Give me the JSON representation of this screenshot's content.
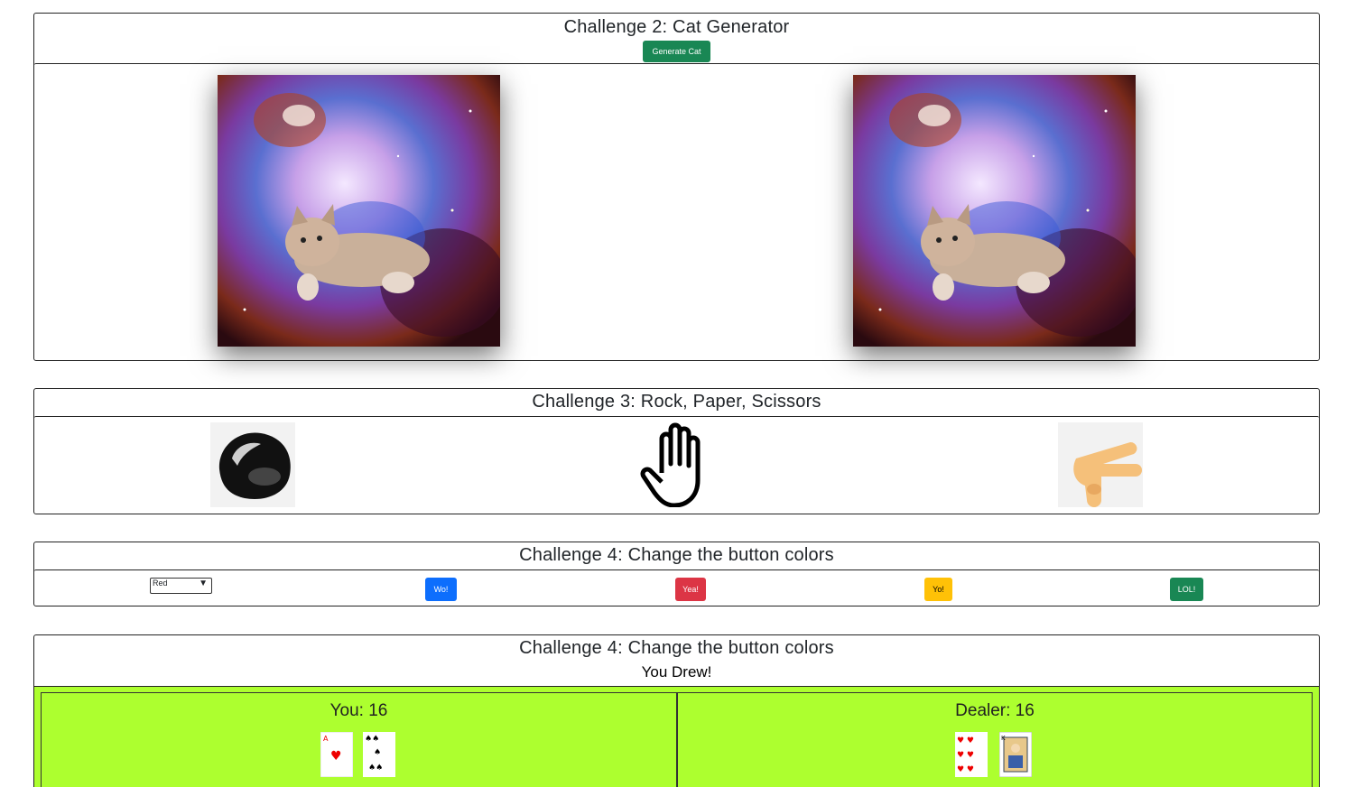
{
  "challenge2": {
    "title": "Challenge 2: Cat Generator",
    "button_label": "Generate Cat",
    "images": [
      "cat-in-space-image",
      "cat-in-space-image"
    ]
  },
  "challenge3": {
    "title": "Challenge 3: Rock, Paper, Scissors",
    "choices": [
      "rock-icon",
      "paper-hand-icon",
      "scissors-hand-icon"
    ]
  },
  "challenge4": {
    "title": "Challenge 4: Change the button colors",
    "select_value": "Red",
    "buttons": [
      {
        "label": "Wo!",
        "color": "#0d6efd"
      },
      {
        "label": "Yea!",
        "color": "#dc3545"
      },
      {
        "label": "Yo!",
        "color": "#ffc107"
      },
      {
        "label": "LOL!",
        "color": "#198754"
      }
    ]
  },
  "blackjack": {
    "title": "Challenge 4: Change the button colors",
    "result": "You Drew!",
    "you_label": "You: 16",
    "dealer_label": "Dealer: 16",
    "you_cards": [
      "ace-of-hearts-card",
      "five-of-spades-card"
    ],
    "dealer_cards": [
      "six-of-hearts-card",
      "king-of-spades-card"
    ],
    "table_color": "#adff2f"
  }
}
